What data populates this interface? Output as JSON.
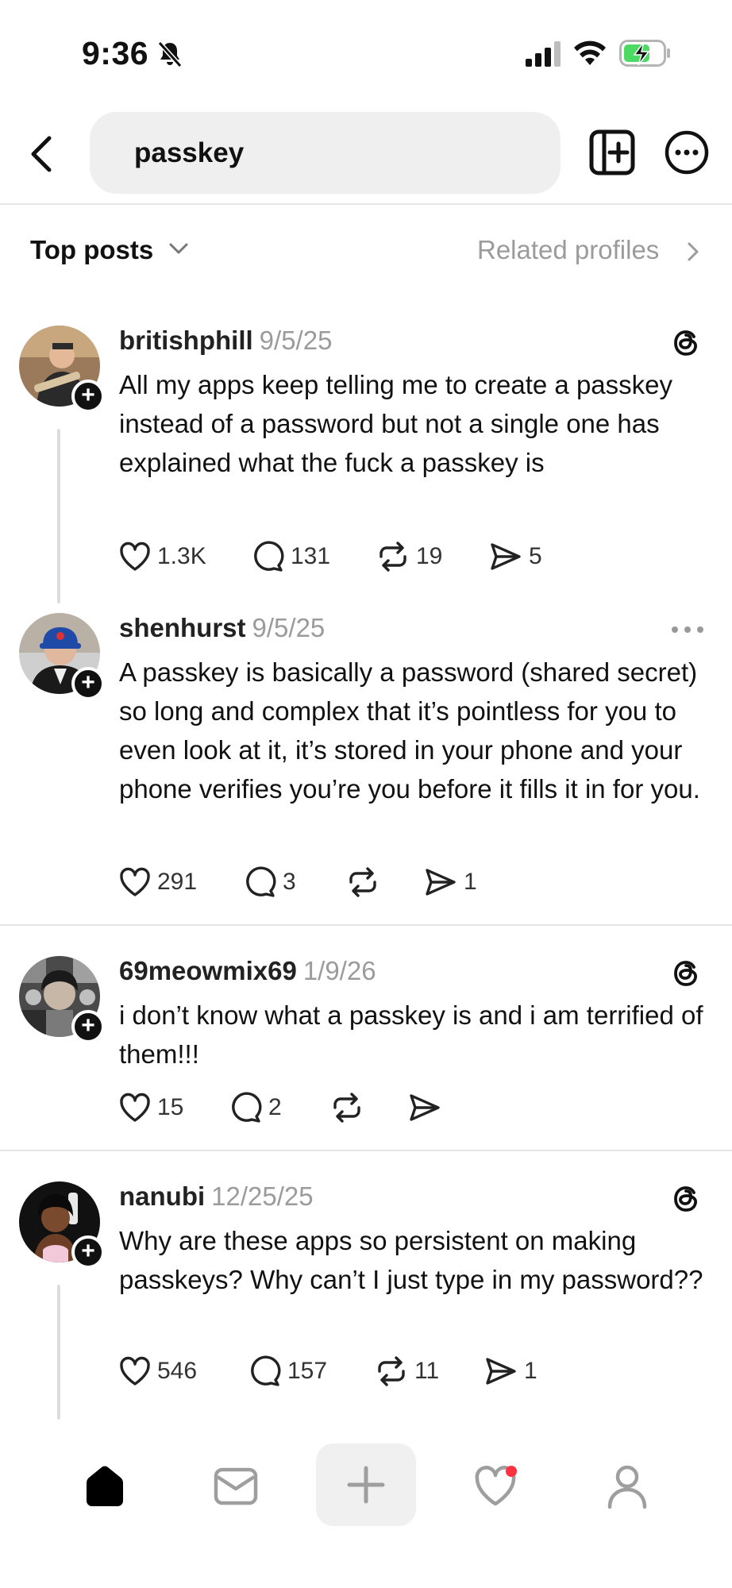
{
  "status_bar": {
    "time": "9:36"
  },
  "search": {
    "query": "passkey"
  },
  "filters": {
    "top_posts": "Top posts",
    "related_profiles": "Related profiles"
  },
  "posts": [
    {
      "username": "britishphill",
      "date": "9/5/25",
      "text": "All my apps keep telling me to create a passkey instead of a password but not a single one has explained what the fuck a passkey is",
      "likes": "1.3K",
      "comments": "131",
      "reposts": "19",
      "shares": "5"
    },
    {
      "username": "shenhurst",
      "date": "9/5/25",
      "text": "A passkey is basically a password (shared secret) so long and complex that it’s pointless for you to even look at it, it’s stored in your phone and your phone verifies you’re you before it fills it in for you.",
      "likes": "291",
      "comments": "3",
      "reposts": "",
      "shares": "1"
    },
    {
      "username": "69meowmix69",
      "date": "1/9/26",
      "text": "i don’t know what a passkey is and i am terrified of them!!!",
      "likes": "15",
      "comments": "2",
      "reposts": "",
      "shares": ""
    },
    {
      "username": "nanubi",
      "date": "12/25/25",
      "text": "Why are these apps so persistent on making passkeys? Why can’t I just type in my password??",
      "likes": "546",
      "comments": "157",
      "reposts": "11",
      "shares": "1"
    }
  ],
  "colors": {
    "accent_notification": "#ff3040",
    "muted_text": "#9b9b9b",
    "divider": "#e6e6e6"
  },
  "icons": [
    "bell-slash-icon",
    "signal-icon",
    "wifi-icon",
    "battery-charging-icon",
    "back-chevron-icon",
    "new-post-icon",
    "more-options-icon",
    "threads-logo-icon",
    "heart-icon",
    "comment-icon",
    "repost-icon",
    "share-icon",
    "home-icon",
    "inbox-icon",
    "plus-icon",
    "activity-heart-icon",
    "profile-icon"
  ]
}
